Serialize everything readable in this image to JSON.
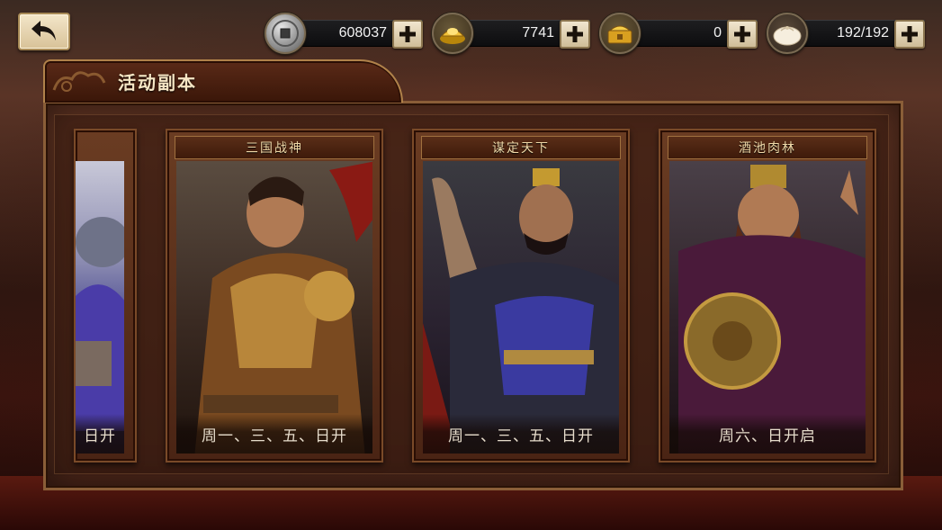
{
  "topbar": {
    "back_icon": "back-arrow-icon",
    "resources": [
      {
        "name": "coin",
        "icon": "copper-coin-icon",
        "value": "608037"
      },
      {
        "name": "gold-ingot",
        "icon": "gold-ingot-icon",
        "value": "7741"
      },
      {
        "name": "gold-chest",
        "icon": "gold-treasure-icon",
        "value": "0"
      },
      {
        "name": "stamina-bun",
        "icon": "steamed-bun-icon",
        "value": "192/192"
      }
    ]
  },
  "panel": {
    "title": "活动副本"
  },
  "cards": [
    {
      "name": "",
      "schedule": "日开"
    },
    {
      "name": "三国战神",
      "schedule": "周一、三、五、日开"
    },
    {
      "name": "谋定天下",
      "schedule": "周一、三、五、日开"
    },
    {
      "name": "酒池肉林",
      "schedule": "周六、日开启"
    }
  ],
  "colors": {
    "accent_gold": "#f0d9a8",
    "frame_brown": "#8a5e38",
    "button_cream": "#f1e6cf"
  }
}
